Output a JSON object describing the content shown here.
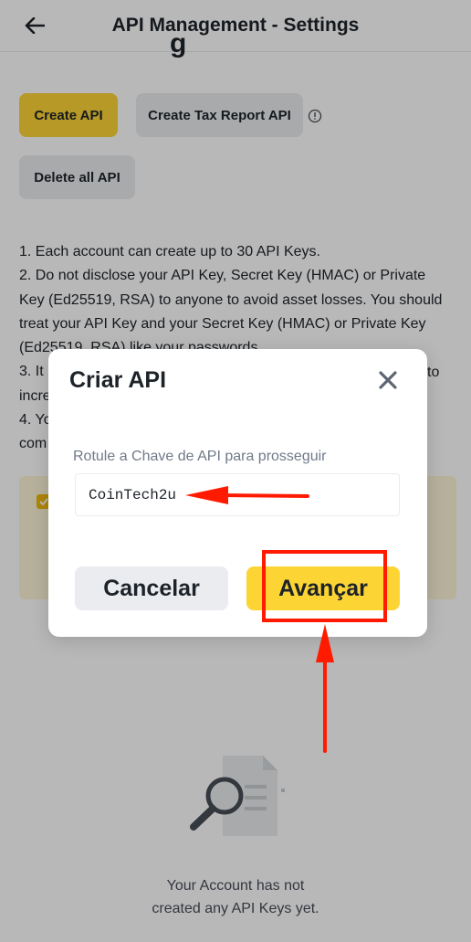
{
  "header": {
    "title": "API Management - Settings",
    "back_icon": "arrow-left-icon"
  },
  "page": {
    "partial_title": "g"
  },
  "actions": {
    "create_api": "Create API",
    "create_tax_report_api": "Create Tax Report API",
    "delete_all_api": "Delete all API",
    "info_icon": "info-circle-icon"
  },
  "notes": [
    "1. Each account can create up to 30 API Keys.",
    "2. Do not disclose your API Key, Secret Key (HMAC) or Private Key (Ed25519, RSA) to anyone to avoid asset losses. You should treat your API Key and your Secret Key (HMAC) or Private Key (Ed25519, RSA) like your passwords.",
    "3. It",
    "incre",
    "4. Yo",
    "com"
  ],
  "notes_right_fragments": [
    "to"
  ],
  "empty_state": {
    "icon": "document-search-icon",
    "line1": "Your Account has not",
    "line2": "created any API Keys yet."
  },
  "modal": {
    "title": "Criar API",
    "close_icon": "close-icon",
    "label": "Rotule a Chave de API para prosseguir",
    "input_value": "CoinTech2u",
    "cancel": "Cancelar",
    "next": "Avançar"
  },
  "colors": {
    "brand_yellow": "#fcd535",
    "annotation_red": "#ff1a00",
    "gray_button": "#eaecef"
  }
}
